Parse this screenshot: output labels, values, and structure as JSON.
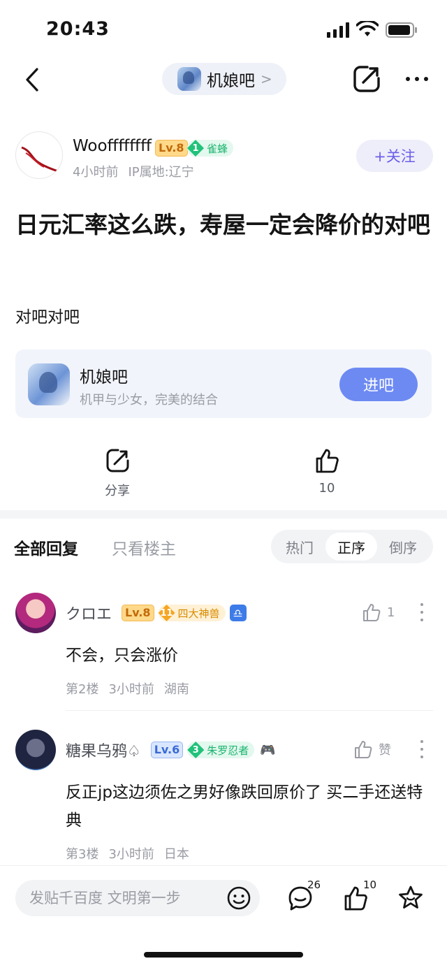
{
  "status_bar": {
    "time": "20:43"
  },
  "nav": {
    "forum_name": "机娘吧",
    "chevron": ">"
  },
  "post": {
    "author": {
      "name": "Wooffffffff",
      "level": "Lv.8",
      "fans_level": "1",
      "fans_title": "雀蜂",
      "time_ago": "4小时前",
      "ip_location": "IP属地:辽宁"
    },
    "follow_label": "+关注",
    "title": "日元汇率这么跌，寿屋一定会降价的对吧",
    "body": "对吧对吧"
  },
  "forum_card": {
    "name": "机娘吧",
    "description": "机甲与少女，完美的结合",
    "enter_label": "进吧"
  },
  "actions": {
    "share_label": "分享",
    "like_count": "10"
  },
  "reply_tabs": {
    "all": "全部回复",
    "op_only": "只看楼主",
    "sort": [
      "热门",
      "正序",
      "倒序"
    ],
    "sort_selected": "正序"
  },
  "comments": [
    {
      "author": "クロエ",
      "level": "Lv.8",
      "fans_level": "11",
      "fans_title": "四大神兽",
      "badge_icon": "libra-zodiac-icon",
      "badge_glyph": "♎",
      "likes": "1",
      "text": "不会，只会涨价",
      "floor": "第2楼",
      "time": "3小时前",
      "location": "湖南"
    },
    {
      "author": "糖果乌鸦♤",
      "level": "Lv.6",
      "fans_level": "3",
      "fans_title": "朱罗忍者",
      "badge_icon": "gamepad-icon",
      "badge_glyph": "🎮",
      "likes": "赞",
      "text": "反正jp这边须佐之男好像跌回原价了 买二手还送特典",
      "floor": "第3楼",
      "time": "3小时前",
      "location": "日本"
    }
  ],
  "bottom_bar": {
    "placeholder": "发贴千百度 文明第一步",
    "comment_count": "26",
    "like_count": "10"
  },
  "colors": {
    "accent": "#6d8af3",
    "follow": "#6b5ee8",
    "muted": "#9a9ca4",
    "fans_green": "#21c27a",
    "fans_gold": "#f5a623"
  }
}
